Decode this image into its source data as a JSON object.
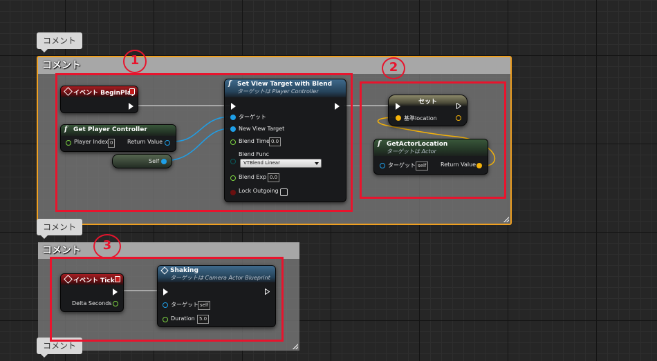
{
  "comments": {
    "label": "コメント",
    "top_tag": "コメント",
    "box1_title": "コメント",
    "mid_tag": "コメント",
    "box2_title": "コメント",
    "bottom_tag": "コメント"
  },
  "annotations": {
    "one": "1",
    "two": "2",
    "three": "3"
  },
  "nodes": {
    "begin_play": {
      "title": "イベント BeginPlay"
    },
    "get_player_controller": {
      "title": "Get Player Controller",
      "player_index_label": "Player Index",
      "player_index_value": "0",
      "return_value_label": "Return Value"
    },
    "self_node": {
      "label": "Self"
    },
    "set_view_target": {
      "title": "Set View Target with Blend",
      "subtitle": "ターゲットは Player Controller",
      "target_label": "ターゲット",
      "new_view_target_label": "New View Target",
      "blend_time_label": "Blend Time",
      "blend_time_value": "0.0",
      "blend_func_label": "Blend Func",
      "blend_func_value": "VTBlend Linear",
      "blend_exp_label": "Blend Exp",
      "blend_exp_value": "0.0",
      "lock_outgoing_label": "Lock Outgoing"
    },
    "set_node": {
      "title": "セット",
      "var_label": "基準location"
    },
    "get_actor_location": {
      "title": "GetActorLocation",
      "subtitle": "ターゲットは Actor",
      "target_label": "ターゲット",
      "target_value": "self",
      "return_value_label": "Return Value"
    },
    "event_tick": {
      "title": "イベント Tick",
      "delta_label": "Delta Seconds"
    },
    "shaking": {
      "title": "Shaking",
      "subtitle": "ターゲットは Camera Actor Blueprint",
      "target_label": "ターゲット",
      "target_value": "self",
      "duration_label": "Duration",
      "duration_value": "5.0"
    }
  },
  "colors": {
    "accent_selected": "#f0a020",
    "annotation_red": "#e8142d",
    "exec_wire": "#ffffff",
    "object_pin": "#1e9fe8",
    "float_pin": "#7cd241",
    "vector_pin": "#f5b30a"
  },
  "icons": {
    "function": "function-f-icon",
    "event": "event-diamond-icon",
    "dropdown": "chevron-down-icon"
  }
}
